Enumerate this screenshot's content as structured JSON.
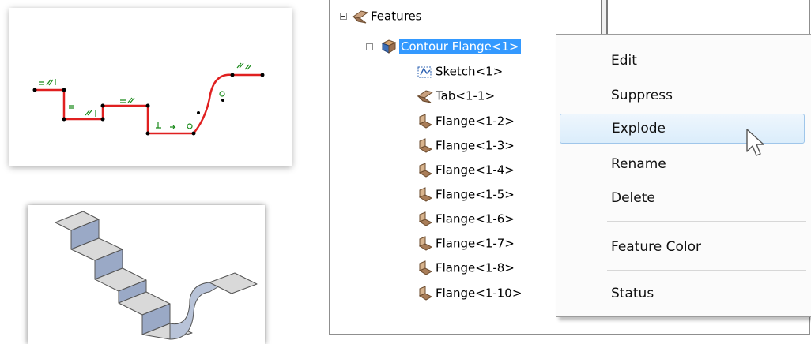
{
  "tree": {
    "root": {
      "label": "Features",
      "icon": "features-icon"
    },
    "feature": {
      "label": "Contour Flange<1>",
      "icon": "contour-flange-icon",
      "selected": true
    },
    "children": [
      {
        "label": "Sketch<1>",
        "icon": "sketch-icon"
      },
      {
        "label": "Tab<1-1>",
        "icon": "tab-icon"
      },
      {
        "label": "Flange<1-2>",
        "icon": "flange-icon"
      },
      {
        "label": "Flange<1-3>",
        "icon": "flange-icon"
      },
      {
        "label": "Flange<1-4>",
        "icon": "flange-icon"
      },
      {
        "label": "Flange<1-5>",
        "icon": "flange-icon"
      },
      {
        "label": "Flange<1-6>",
        "icon": "flange-icon"
      },
      {
        "label": "Flange<1-7>",
        "icon": "flange-icon"
      },
      {
        "label": "Flange<1-8>",
        "icon": "flange-icon"
      },
      {
        "label": "Flange<1-10>",
        "icon": "flange-icon"
      }
    ]
  },
  "context_menu": {
    "items": [
      {
        "label": "Edit"
      },
      {
        "label": "Suppress"
      },
      {
        "label": "Explode",
        "hovered": true
      },
      {
        "label": "Rename"
      },
      {
        "label": "Delete"
      },
      {
        "label": "Feature Color"
      },
      {
        "label": "Status"
      }
    ]
  },
  "colors": {
    "selection": "#3399ff",
    "sketch_line": "#e02020",
    "constraint": "#1a8a1a",
    "sheet_top": "#d8d8d8",
    "sheet_side": "#9aa9c6"
  },
  "icons": {
    "cursor": "arrow-cursor-icon",
    "collapse": "collapse-toggle-icon"
  }
}
